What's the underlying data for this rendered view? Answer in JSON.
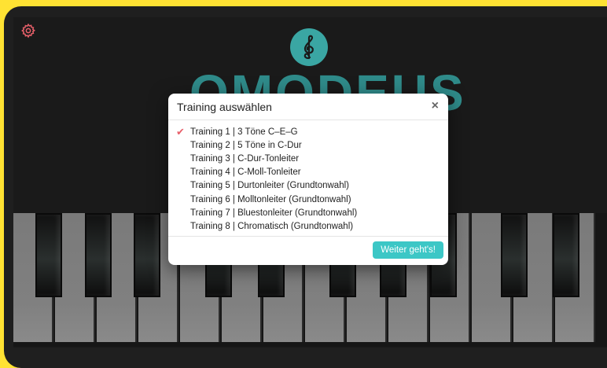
{
  "app": {
    "brand": "OMODEUS"
  },
  "dialog": {
    "title": "Training auswählen",
    "close_label": "×",
    "items": [
      {
        "label": "Training 1  |  3 Töne C–E–G",
        "selected": true
      },
      {
        "label": "Training 2  |  5 Töne in C-Dur",
        "selected": false
      },
      {
        "label": "Training 3  |  C-Dur-Tonleiter",
        "selected": false
      },
      {
        "label": "Training 4  |  C-Moll-Tonleiter",
        "selected": false
      },
      {
        "label": "Training 5  |  Durtonleiter (Grundtonwahl)",
        "selected": false
      },
      {
        "label": "Training 6  |  Molltonleiter (Grundtonwahl)",
        "selected": false
      },
      {
        "label": "Training 7  |  Bluestonleiter (Grundtonwahl)",
        "selected": false
      },
      {
        "label": "Training 8  |  Chromatisch (Grundtonwahl)",
        "selected": false
      }
    ],
    "check_glyph": "✔",
    "continue_label": "Weiter geht's!"
  },
  "colors": {
    "accent": "#3cc7c6",
    "check": "#e8606a",
    "brand": "#2f8b8a",
    "frame": "#ffe233"
  },
  "icons": {
    "settings": "gear-icon",
    "logo": "treble-clef-icon"
  }
}
